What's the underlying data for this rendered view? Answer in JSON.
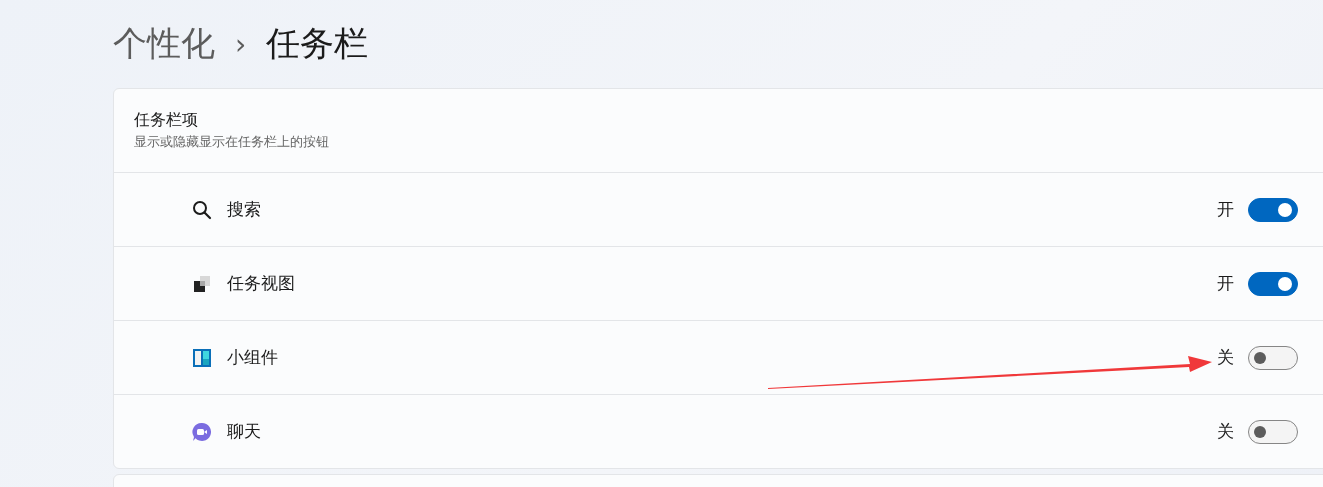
{
  "breadcrumb": {
    "parent": "个性化",
    "separator": "›",
    "current": "任务栏"
  },
  "section": {
    "title": "任务栏项",
    "subtitle": "显示或隐藏显示在任务栏上的按钮"
  },
  "items": [
    {
      "kind": "search",
      "label": "搜索",
      "state_label": "开",
      "on": true
    },
    {
      "kind": "taskview",
      "label": "任务视图",
      "state_label": "开",
      "on": true
    },
    {
      "kind": "widgets",
      "label": "小组件",
      "state_label": "关",
      "on": false
    },
    {
      "kind": "chat",
      "label": "聊天",
      "state_label": "关",
      "on": false
    }
  ]
}
